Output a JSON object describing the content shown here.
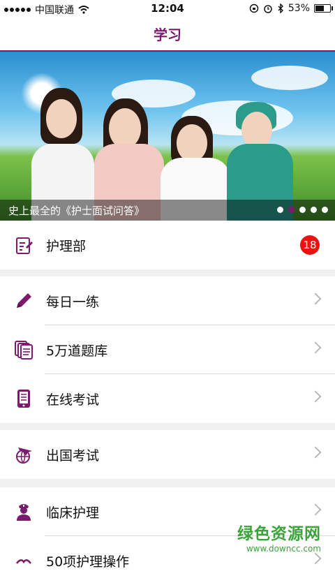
{
  "status": {
    "carrier": "中国联通",
    "time": "12:04",
    "battery": "53%",
    "battery_level": 0.53
  },
  "header": {
    "title": "学习"
  },
  "banner": {
    "caption": "史上最全的《护士面试问答》",
    "pages": 5,
    "active_page": 1
  },
  "sections": [
    {
      "items": [
        {
          "label": "护理部",
          "icon": "clipboard-edit-icon",
          "badge": "18"
        }
      ]
    },
    {
      "items": [
        {
          "label": "每日一练",
          "icon": "pencil-icon"
        },
        {
          "label": "5万道题库",
          "icon": "stacked-documents-icon"
        },
        {
          "label": "在线考试",
          "icon": "tablet-icon"
        }
      ]
    },
    {
      "items": [
        {
          "label": "出国考试",
          "icon": "plane-globe-icon"
        }
      ]
    },
    {
      "items": [
        {
          "label": "临床护理",
          "icon": "nurse-icon"
        },
        {
          "label": "50项护理操作",
          "icon": "hands-icon"
        }
      ]
    }
  ],
  "watermark": {
    "line1": "绿色资源网",
    "line2": "www.downcc.com"
  },
  "colors": {
    "accent": "#7c1a6e",
    "badge": "#ee1111"
  }
}
